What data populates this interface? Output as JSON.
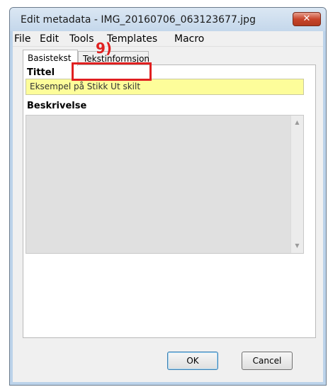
{
  "window": {
    "title": "Edit metadata - IMG_20160706_063123677.jpg",
    "close_glyph": "✕"
  },
  "menu": {
    "items": [
      "File",
      "Edit",
      "Tools",
      "Templates",
      "Macro"
    ]
  },
  "tabs": [
    {
      "label": "Basistekst",
      "active": true
    },
    {
      "label": "Tekstinformsjon",
      "active": false
    }
  ],
  "annotation": {
    "label": "9)",
    "color": "#e02020"
  },
  "form": {
    "title_label": "Tittel",
    "title_value": "Eksempel på Stikk Ut skilt",
    "description_label": "Beskrivelse",
    "description_value": ""
  },
  "buttons": {
    "ok": "OK",
    "cancel": "Cancel"
  },
  "colors": {
    "title_field_bg": "#fdfd9a",
    "close_button": "#c8452b"
  },
  "icons": [
    "close-icon",
    "scroll-up-icon",
    "scroll-down-icon"
  ]
}
